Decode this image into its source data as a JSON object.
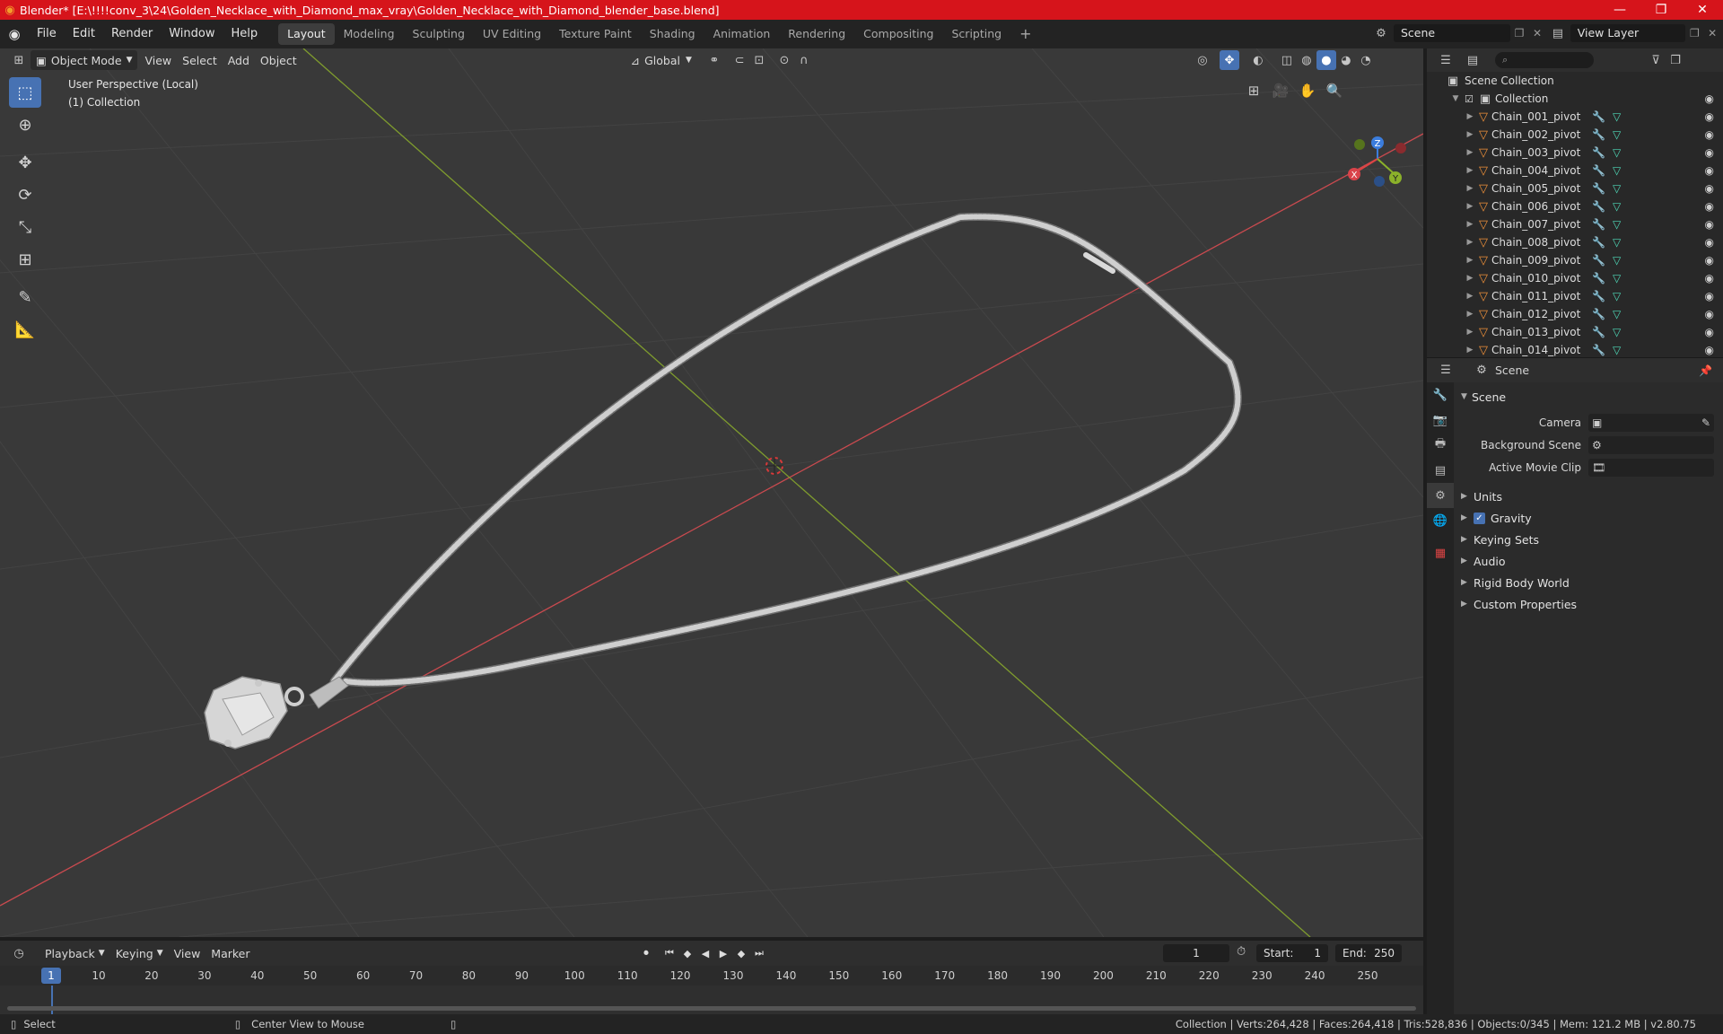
{
  "window": {
    "title": "Blender* [E:\\!!!!conv_3\\24\\Golden_Necklace_with_Diamond_max_vray\\Golden_Necklace_with_Diamond_blender_base.blend]",
    "minimize": "—",
    "maximize": "❐",
    "close": "✕"
  },
  "menu": {
    "file": "File",
    "edit": "Edit",
    "render": "Render",
    "window": "Window",
    "help": "Help"
  },
  "workspaces": [
    "Layout",
    "Modeling",
    "Sculpting",
    "UV Editing",
    "Texture Paint",
    "Shading",
    "Animation",
    "Rendering",
    "Compositing",
    "Scripting"
  ],
  "scene_selector": {
    "value": "Scene"
  },
  "view_layer_selector": {
    "value": "View Layer"
  },
  "viewport": {
    "mode": "Object Mode",
    "view_menu": "View",
    "select_menu": "Select",
    "add_menu": "Add",
    "object_menu": "Object",
    "orientation": "Global",
    "info_line1": "User Perspective (Local)",
    "info_line2": "(1) Collection",
    "gizmo_x": "X",
    "gizmo_y": "Y",
    "gizmo_z": "Z"
  },
  "outliner": {
    "search_placeholder": "",
    "scene_collection": "Scene Collection",
    "collection": "Collection",
    "items": [
      "Chain_001_pivot",
      "Chain_002_pivot",
      "Chain_003_pivot",
      "Chain_004_pivot",
      "Chain_005_pivot",
      "Chain_006_pivot",
      "Chain_007_pivot",
      "Chain_008_pivot",
      "Chain_009_pivot",
      "Chain_010_pivot",
      "Chain_011_pivot",
      "Chain_012_pivot",
      "Chain_013_pivot",
      "Chain_014_pivot"
    ]
  },
  "properties": {
    "header": "Scene",
    "panel": "Scene",
    "camera_label": "Camera",
    "background_scene_label": "Background Scene",
    "active_movie_clip_label": "Active Movie Clip",
    "subpanels": {
      "units": "Units",
      "gravity": "Gravity",
      "keying_sets": "Keying Sets",
      "audio": "Audio",
      "rigid_body_world": "Rigid Body World",
      "custom_properties": "Custom Properties"
    }
  },
  "timeline": {
    "playback": "Playback",
    "keying": "Keying",
    "view": "View",
    "marker": "Marker",
    "current_frame": "1",
    "start_label": "Start:",
    "start": "1",
    "end_label": "End:",
    "end": "250",
    "ticks": [
      "1",
      "10",
      "20",
      "30",
      "40",
      "50",
      "60",
      "70",
      "80",
      "90",
      "100",
      "110",
      "120",
      "130",
      "140",
      "150",
      "160",
      "170",
      "180",
      "190",
      "200",
      "210",
      "220",
      "230",
      "240",
      "250"
    ]
  },
  "statusbar": {
    "select": "Select",
    "center_view": "Center View to Mouse",
    "stats": "Collection | Verts:264,428 | Faces:264,418 | Tris:528,836 | Objects:0/345 | Mem: 121.2 MB | v2.80.75"
  },
  "colors": {
    "title_bar": "#d6141b",
    "accent": "#4772b3",
    "x_axis": "#c94a4f",
    "y_axis": "#7f9c2e"
  }
}
